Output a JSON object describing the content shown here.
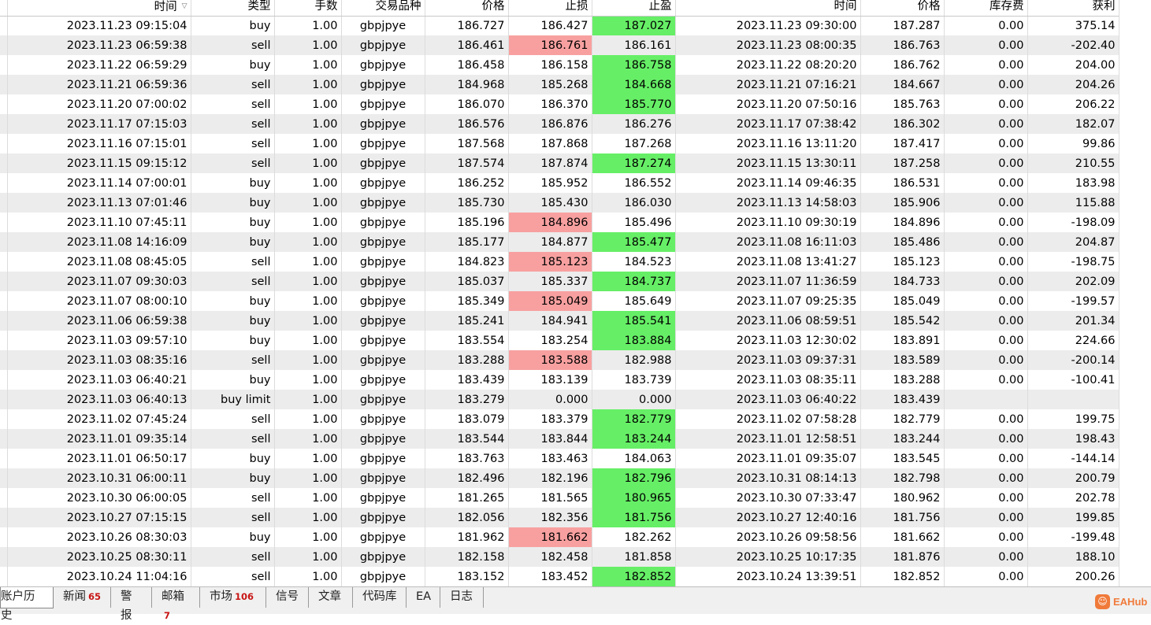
{
  "columns": [
    "时间",
    "类型",
    "手数",
    "交易品种",
    "价格",
    "止损",
    "止盈",
    "时间",
    "价格",
    "库存费",
    "获利"
  ],
  "sort_indicator": "▽",
  "rows": [
    {
      "open_time": "2023.11.23 09:15:04",
      "type": "buy",
      "lots": "1.00",
      "symbol": "gbpjpye",
      "price": "186.727",
      "sl": "186.427",
      "tp": "187.027",
      "close_time": "2023.11.23 09:30:00",
      "close_price": "187.287",
      "swap": "0.00",
      "profit": "375.14",
      "hit": "tp"
    },
    {
      "open_time": "2023.11.23 06:59:38",
      "type": "sell",
      "lots": "1.00",
      "symbol": "gbpjpye",
      "price": "186.461",
      "sl": "186.761",
      "tp": "186.161",
      "close_time": "2023.11.23 08:00:35",
      "close_price": "186.763",
      "swap": "0.00",
      "profit": "-202.40",
      "hit": "sl"
    },
    {
      "open_time": "2023.11.22 06:59:29",
      "type": "buy",
      "lots": "1.00",
      "symbol": "gbpjpye",
      "price": "186.458",
      "sl": "186.158",
      "tp": "186.758",
      "close_time": "2023.11.22 08:20:20",
      "close_price": "186.762",
      "swap": "0.00",
      "profit": "204.00",
      "hit": "tp"
    },
    {
      "open_time": "2023.11.21 06:59:36",
      "type": "sell",
      "lots": "1.00",
      "symbol": "gbpjpye",
      "price": "184.968",
      "sl": "185.268",
      "tp": "184.668",
      "close_time": "2023.11.21 07:16:21",
      "close_price": "184.667",
      "swap": "0.00",
      "profit": "204.26",
      "hit": "tp"
    },
    {
      "open_time": "2023.11.20 07:00:02",
      "type": "sell",
      "lots": "1.00",
      "symbol": "gbpjpye",
      "price": "186.070",
      "sl": "186.370",
      "tp": "185.770",
      "close_time": "2023.11.20 07:50:16",
      "close_price": "185.763",
      "swap": "0.00",
      "profit": "206.22",
      "hit": "tp"
    },
    {
      "open_time": "2023.11.17 07:15:03",
      "type": "sell",
      "lots": "1.00",
      "symbol": "gbpjpye",
      "price": "186.576",
      "sl": "186.876",
      "tp": "186.276",
      "close_time": "2023.11.17 07:38:42",
      "close_price": "186.302",
      "swap": "0.00",
      "profit": "182.07",
      "hit": ""
    },
    {
      "open_time": "2023.11.16 07:15:01",
      "type": "sell",
      "lots": "1.00",
      "symbol": "gbpjpye",
      "price": "187.568",
      "sl": "187.868",
      "tp": "187.268",
      "close_time": "2023.11.16 13:11:20",
      "close_price": "187.417",
      "swap": "0.00",
      "profit": "99.86",
      "hit": ""
    },
    {
      "open_time": "2023.11.15 09:15:12",
      "type": "sell",
      "lots": "1.00",
      "symbol": "gbpjpye",
      "price": "187.574",
      "sl": "187.874",
      "tp": "187.274",
      "close_time": "2023.11.15 13:30:11",
      "close_price": "187.258",
      "swap": "0.00",
      "profit": "210.55",
      "hit": "tp"
    },
    {
      "open_time": "2023.11.14 07:00:01",
      "type": "buy",
      "lots": "1.00",
      "symbol": "gbpjpye",
      "price": "186.252",
      "sl": "185.952",
      "tp": "186.552",
      "close_time": "2023.11.14 09:46:35",
      "close_price": "186.531",
      "swap": "0.00",
      "profit": "183.98",
      "hit": ""
    },
    {
      "open_time": "2023.11.13 07:01:46",
      "type": "buy",
      "lots": "1.00",
      "symbol": "gbpjpye",
      "price": "185.730",
      "sl": "185.430",
      "tp": "186.030",
      "close_time": "2023.11.13 14:58:03",
      "close_price": "185.906",
      "swap": "0.00",
      "profit": "115.88",
      "hit": ""
    },
    {
      "open_time": "2023.11.10 07:45:11",
      "type": "buy",
      "lots": "1.00",
      "symbol": "gbpjpye",
      "price": "185.196",
      "sl": "184.896",
      "tp": "185.496",
      "close_time": "2023.11.10 09:30:19",
      "close_price": "184.896",
      "swap": "0.00",
      "profit": "-198.09",
      "hit": "sl"
    },
    {
      "open_time": "2023.11.08 14:16:09",
      "type": "buy",
      "lots": "1.00",
      "symbol": "gbpjpye",
      "price": "185.177",
      "sl": "184.877",
      "tp": "185.477",
      "close_time": "2023.11.08 16:11:03",
      "close_price": "185.486",
      "swap": "0.00",
      "profit": "204.87",
      "hit": "tp"
    },
    {
      "open_time": "2023.11.08 08:45:05",
      "type": "sell",
      "lots": "1.00",
      "symbol": "gbpjpye",
      "price": "184.823",
      "sl": "185.123",
      "tp": "184.523",
      "close_time": "2023.11.08 13:41:27",
      "close_price": "185.123",
      "swap": "0.00",
      "profit": "-198.75",
      "hit": "sl"
    },
    {
      "open_time": "2023.11.07 09:30:03",
      "type": "sell",
      "lots": "1.00",
      "symbol": "gbpjpye",
      "price": "185.037",
      "sl": "185.337",
      "tp": "184.737",
      "close_time": "2023.11.07 11:36:59",
      "close_price": "184.733",
      "swap": "0.00",
      "profit": "202.09",
      "hit": "tp"
    },
    {
      "open_time": "2023.11.07 08:00:10",
      "type": "buy",
      "lots": "1.00",
      "symbol": "gbpjpye",
      "price": "185.349",
      "sl": "185.049",
      "tp": "185.649",
      "close_time": "2023.11.07 09:25:35",
      "close_price": "185.049",
      "swap": "0.00",
      "profit": "-199.57",
      "hit": "sl"
    },
    {
      "open_time": "2023.11.06 06:59:38",
      "type": "buy",
      "lots": "1.00",
      "symbol": "gbpjpye",
      "price": "185.241",
      "sl": "184.941",
      "tp": "185.541",
      "close_time": "2023.11.06 08:59:51",
      "close_price": "185.542",
      "swap": "0.00",
      "profit": "201.34",
      "hit": "tp"
    },
    {
      "open_time": "2023.11.03 09:57:10",
      "type": "buy",
      "lots": "1.00",
      "symbol": "gbpjpye",
      "price": "183.554",
      "sl": "183.254",
      "tp": "183.884",
      "close_time": "2023.11.03 12:30:02",
      "close_price": "183.891",
      "swap": "0.00",
      "profit": "224.66",
      "hit": "tp"
    },
    {
      "open_time": "2023.11.03 08:35:16",
      "type": "sell",
      "lots": "1.00",
      "symbol": "gbpjpye",
      "price": "183.288",
      "sl": "183.588",
      "tp": "182.988",
      "close_time": "2023.11.03 09:37:31",
      "close_price": "183.589",
      "swap": "0.00",
      "profit": "-200.14",
      "hit": "sl"
    },
    {
      "open_time": "2023.11.03 06:40:21",
      "type": "buy",
      "lots": "1.00",
      "symbol": "gbpjpye",
      "price": "183.439",
      "sl": "183.139",
      "tp": "183.739",
      "close_time": "2023.11.03 08:35:11",
      "close_price": "183.288",
      "swap": "0.00",
      "profit": "-100.41",
      "hit": ""
    },
    {
      "open_time": "2023.11.03 06:40:13",
      "type": "buy limit",
      "lots": "1.00",
      "symbol": "gbpjpye",
      "price": "183.279",
      "sl": "0.000",
      "tp": "0.000",
      "close_time": "2023.11.03 06:40:22",
      "close_price": "183.439",
      "swap": "",
      "profit": "",
      "hit": ""
    },
    {
      "open_time": "2023.11.02 07:45:24",
      "type": "sell",
      "lots": "1.00",
      "symbol": "gbpjpye",
      "price": "183.079",
      "sl": "183.379",
      "tp": "182.779",
      "close_time": "2023.11.02 07:58:28",
      "close_price": "182.779",
      "swap": "0.00",
      "profit": "199.75",
      "hit": "tp"
    },
    {
      "open_time": "2023.11.01 09:35:14",
      "type": "sell",
      "lots": "1.00",
      "symbol": "gbpjpye",
      "price": "183.544",
      "sl": "183.844",
      "tp": "183.244",
      "close_time": "2023.11.01 12:58:51",
      "close_price": "183.244",
      "swap": "0.00",
      "profit": "198.43",
      "hit": "tp"
    },
    {
      "open_time": "2023.11.01 06:50:17",
      "type": "buy",
      "lots": "1.00",
      "symbol": "gbpjpye",
      "price": "183.763",
      "sl": "183.463",
      "tp": "184.063",
      "close_time": "2023.11.01 09:35:07",
      "close_price": "183.545",
      "swap": "0.00",
      "profit": "-144.14",
      "hit": ""
    },
    {
      "open_time": "2023.10.31 06:00:11",
      "type": "buy",
      "lots": "1.00",
      "symbol": "gbpjpye",
      "price": "182.496",
      "sl": "182.196",
      "tp": "182.796",
      "close_time": "2023.10.31 08:14:13",
      "close_price": "182.798",
      "swap": "0.00",
      "profit": "200.79",
      "hit": "tp"
    },
    {
      "open_time": "2023.10.30 06:00:05",
      "type": "sell",
      "lots": "1.00",
      "symbol": "gbpjpye",
      "price": "181.265",
      "sl": "181.565",
      "tp": "180.965",
      "close_time": "2023.10.30 07:33:47",
      "close_price": "180.962",
      "swap": "0.00",
      "profit": "202.78",
      "hit": "tp"
    },
    {
      "open_time": "2023.10.27 07:15:15",
      "type": "sell",
      "lots": "1.00",
      "symbol": "gbpjpye",
      "price": "182.056",
      "sl": "182.356",
      "tp": "181.756",
      "close_time": "2023.10.27 12:40:16",
      "close_price": "181.756",
      "swap": "0.00",
      "profit": "199.85",
      "hit": "tp"
    },
    {
      "open_time": "2023.10.26 08:30:03",
      "type": "buy",
      "lots": "1.00",
      "symbol": "gbpjpye",
      "price": "181.962",
      "sl": "181.662",
      "tp": "182.262",
      "close_time": "2023.10.26 09:58:56",
      "close_price": "181.662",
      "swap": "0.00",
      "profit": "-199.48",
      "hit": "sl"
    },
    {
      "open_time": "2023.10.25 08:30:11",
      "type": "sell",
      "lots": "1.00",
      "symbol": "gbpjpye",
      "price": "182.158",
      "sl": "182.458",
      "tp": "181.858",
      "close_time": "2023.10.25 10:17:35",
      "close_price": "181.876",
      "swap": "0.00",
      "profit": "188.10",
      "hit": ""
    },
    {
      "open_time": "2023.10.24 11:04:16",
      "type": "sell",
      "lots": "1.00",
      "symbol": "gbpjpye",
      "price": "183.152",
      "sl": "183.452",
      "tp": "182.852",
      "close_time": "2023.10.24 13:39:51",
      "close_price": "182.852",
      "swap": "0.00",
      "profit": "200.26",
      "hit": "tp"
    }
  ],
  "tabs": [
    {
      "label": "账户历史",
      "badge": "",
      "active": true
    },
    {
      "label": "新闻",
      "badge": "65",
      "active": false
    },
    {
      "label": "警报",
      "badge": "",
      "active": false
    },
    {
      "label": "邮箱",
      "badge": "7",
      "active": false
    },
    {
      "label": "市场",
      "badge": "106",
      "active": false
    },
    {
      "label": "信号",
      "badge": "",
      "active": false
    },
    {
      "label": "文章",
      "badge": "",
      "active": false
    },
    {
      "label": "代码库",
      "badge": "",
      "active": false
    },
    {
      "label": "EA",
      "badge": "",
      "active": false
    },
    {
      "label": "日志",
      "badge": "",
      "active": false
    }
  ],
  "brand": {
    "icon": "eahub-logo-icon",
    "label": "EAHub",
    "color": "#f07a3a"
  },
  "colors": {
    "sl_hit": "#f8a0a0",
    "tp_hit": "#66ef66",
    "row_alt": "#ececec"
  }
}
